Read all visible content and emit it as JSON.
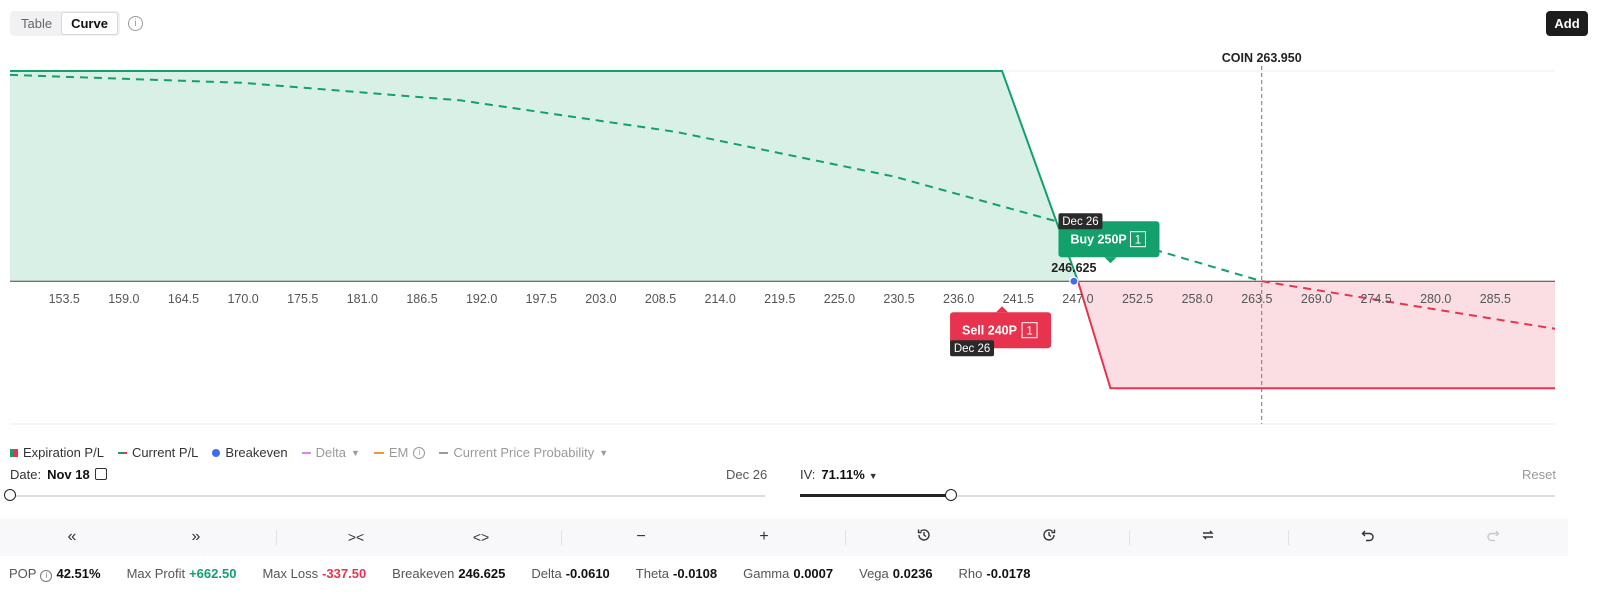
{
  "view_toggle": {
    "options": [
      "Table",
      "Curve"
    ],
    "active": "Curve"
  },
  "toolbar_top": {
    "add_label": "Add"
  },
  "colors": {
    "profit": "#13a06b",
    "loss": "#e8334f",
    "breakeven": "#3d6df2",
    "dark": "#1d1d1d"
  },
  "chart_data": {
    "type": "area",
    "x_ticks": [
      "153.5",
      "159.0",
      "164.5",
      "170.0",
      "175.5",
      "181.0",
      "186.5",
      "192.0",
      "197.5",
      "203.0",
      "208.5",
      "214.0",
      "219.5",
      "225.0",
      "230.5",
      "236.0",
      "241.5",
      "247.0",
      "252.5",
      "258.0",
      "263.5",
      "269.0",
      "274.5",
      "280.0",
      "285.5"
    ],
    "xlim": [
      148.5,
      291.0
    ],
    "ylim": [
      -450,
      760
    ],
    "expiration_pl": {
      "x": [
        148.5,
        240.0,
        247.0,
        250.0,
        291.0
      ],
      "y": [
        662.5,
        662.5,
        0,
        -337.5,
        -337.5
      ]
    },
    "current_pl": {
      "x": [
        148.5,
        170.0,
        190.0,
        210.0,
        230.0,
        247.0,
        263.95,
        291.0
      ],
      "y": [
        650,
        625,
        570,
        470,
        330,
        170,
        0,
        -150
      ]
    },
    "underlying": {
      "label": "COIN 263.950",
      "price": 263.95
    },
    "breakeven": {
      "price": 246.625,
      "label": "246.625"
    },
    "legs": [
      {
        "label": "Buy 250P",
        "qty": "1",
        "date": "Dec 26",
        "strike": 250,
        "side": "buy"
      },
      {
        "label": "Sell 240P",
        "qty": "1",
        "date": "Dec 26",
        "strike": 240,
        "side": "sell"
      }
    ]
  },
  "legend": {
    "expiration": "Expiration P/L",
    "current": "Current P/L",
    "breakeven": "Breakeven",
    "delta": "Delta",
    "em": "EM",
    "cpp": "Current Price Probability"
  },
  "controls": {
    "date_label": "Date:",
    "date_value": "Nov 18",
    "date_end": "Dec 26",
    "date_fraction": 0.0,
    "iv_label": "IV:",
    "iv_value": "71.11%",
    "iv_fraction": 0.2,
    "reset_label": "Reset"
  },
  "stats": {
    "pop_label": "POP",
    "pop": "42.51%",
    "max_profit_label": "Max Profit",
    "max_profit": "+662.50",
    "max_loss_label": "Max Loss",
    "max_loss": "-337.50",
    "breakeven_label": "Breakeven",
    "breakeven": "246.625",
    "delta_label": "Delta",
    "delta": "-0.0610",
    "theta_label": "Theta",
    "theta": "-0.0108",
    "gamma_label": "Gamma",
    "gamma": "0.0007",
    "vega_label": "Vega",
    "vega": "0.0236",
    "rho_label": "Rho",
    "rho": "-0.0178"
  }
}
